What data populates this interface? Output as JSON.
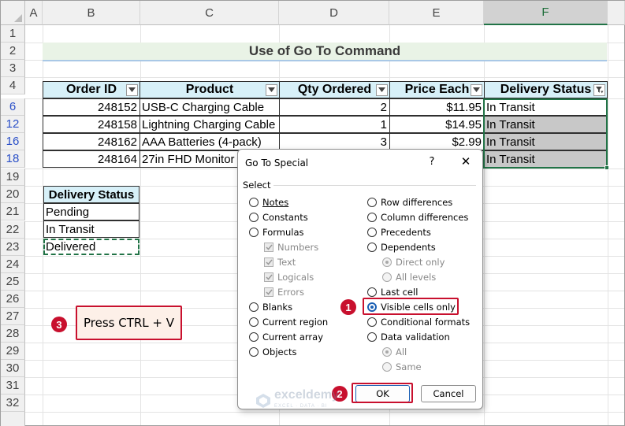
{
  "columns": [
    "A",
    "B",
    "C",
    "D",
    "E",
    "F"
  ],
  "rows": [
    "1",
    "2",
    "3",
    "4",
    "6",
    "12",
    "16",
    "18",
    "19",
    "20",
    "21",
    "22",
    "23",
    "24",
    "25",
    "26",
    "27",
    "28",
    "29",
    "30",
    "31",
    "32"
  ],
  "title": "Use of Go To Command",
  "table": {
    "headers": [
      "Order ID",
      "Product",
      "Qty Ordered",
      "Price Each",
      "Delivery Status"
    ],
    "rows": [
      [
        "248152",
        "USB-C Charging Cable",
        "2",
        "$11.95",
        "In Transit"
      ],
      [
        "248158",
        "Lightning Charging Cable",
        "1",
        "$14.95",
        "In Transit"
      ],
      [
        "248162",
        "AAA Batteries (4-pack)",
        "3",
        "$2.99",
        "In Transit"
      ],
      [
        "248164",
        "27in FHD Monitor",
        "",
        "",
        "In Transit"
      ]
    ]
  },
  "status_list": {
    "header": "Delivery Status",
    "items": [
      "Pending",
      "In Transit",
      "Delivered"
    ]
  },
  "callouts": {
    "step1": "1",
    "step2": "2",
    "step3": "3",
    "press_text": "Press CTRL + V"
  },
  "dialog": {
    "title": "Go To Special",
    "help": "?",
    "close": "✕",
    "select_label": "Select",
    "left_options": [
      "Notes",
      "Constants",
      "Formulas",
      "Blanks",
      "Current region",
      "Current array",
      "Objects"
    ],
    "formula_subs": [
      "Numbers",
      "Text",
      "Logicals",
      "Errors"
    ],
    "right_options": [
      "Row differences",
      "Column differences",
      "Precedents",
      "Dependents",
      "Last cell",
      "Visible cells only",
      "Conditional formats",
      "Data validation"
    ],
    "dependents_subs": [
      "Direct only",
      "All levels"
    ],
    "validation_subs": [
      "All",
      "Same"
    ],
    "selected_option": "Visible cells only",
    "ok": "OK",
    "cancel": "Cancel"
  },
  "watermark": {
    "name": "exceldemy",
    "tagline": "EXCEL · DATA · BI"
  },
  "colors": {
    "accent_green": "#217346",
    "callout_red": "#c8102e",
    "header_fill": "#d7f0f8",
    "title_fill": "#e9f3e6"
  }
}
